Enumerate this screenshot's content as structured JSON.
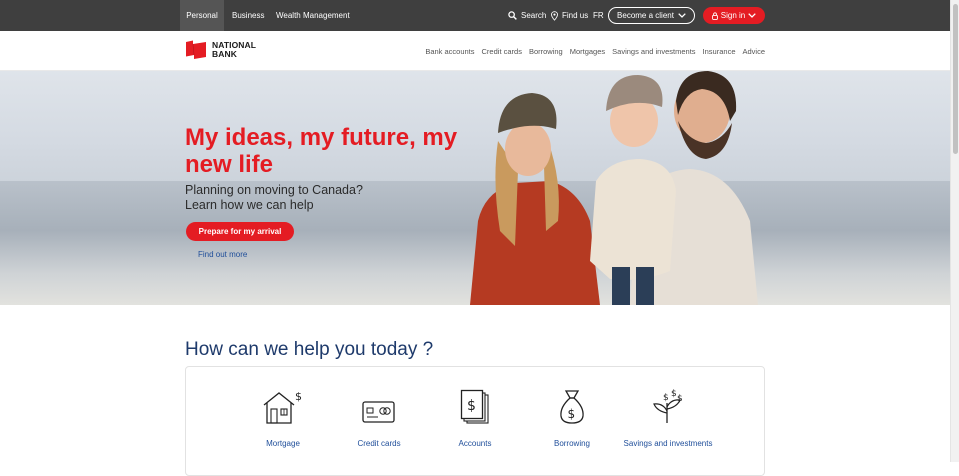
{
  "topbar": {
    "tabs": [
      {
        "label": "Personal",
        "active": true
      },
      {
        "label": "Business",
        "active": false
      },
      {
        "label": "Wealth Management",
        "active": false
      }
    ],
    "search_label": "Search",
    "findus_label": "Find us",
    "lang_label": "FR",
    "become_client_label": "Become a client",
    "signin_label": "Sign in"
  },
  "logo": {
    "line1": "NATIONAL",
    "line2": "BANK"
  },
  "nav": {
    "items": [
      "Bank accounts",
      "Credit cards",
      "Borrowing",
      "Mortgages",
      "Savings and investments",
      "Insurance",
      "Advice"
    ]
  },
  "hero": {
    "title": "My ideas, my future, my new life",
    "subtitle_line1": "Planning on moving to Canada?",
    "subtitle_line2": "Learn how we can help",
    "cta_label": "Prepare for my arrival",
    "link_label": "Find out more"
  },
  "help": {
    "title": "How can we help you today ?",
    "items": [
      {
        "label": "Mortgage",
        "icon": "house-dollar-icon"
      },
      {
        "label": "Credit cards",
        "icon": "credit-card-icon"
      },
      {
        "label": "Accounts",
        "icon": "document-dollar-icon"
      },
      {
        "label": "Borrowing",
        "icon": "money-bag-icon"
      },
      {
        "label": "Savings and investments",
        "icon": "plant-dollar-icon"
      }
    ]
  },
  "colors": {
    "brand_red": "#e41c23",
    "topbar_bg": "#3f3f3f",
    "link_blue": "#1f4e9a",
    "heading_navy": "#1e3a6b"
  }
}
